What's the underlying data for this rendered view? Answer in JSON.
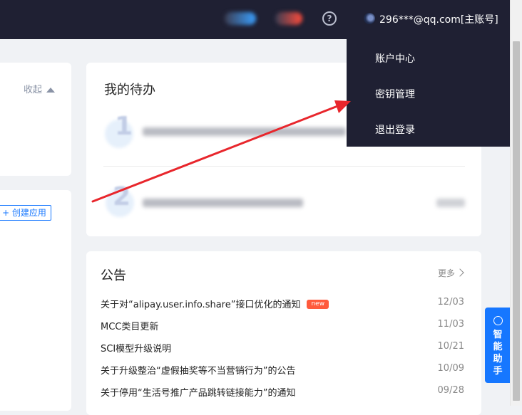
{
  "header": {
    "account_label": "296***@qq.com[主账号]",
    "help_symbol": "?"
  },
  "account_menu": {
    "items": [
      "账户中心",
      "密钥管理",
      "退出登录"
    ]
  },
  "left_panel": {
    "collapse_label": "收起",
    "create_app_label": "+ 创建应用"
  },
  "todo": {
    "title": "我的待办",
    "items": [
      {
        "index": "1"
      },
      {
        "index": "2"
      }
    ]
  },
  "announcements": {
    "title": "公告",
    "more_label": "更多",
    "items": [
      {
        "text": "关于对“alipay.user.info.share”接口优化的通知",
        "date": "12/03",
        "badge": "new"
      },
      {
        "text": "MCC类目更新",
        "date": "11/03"
      },
      {
        "text": "SCI模型升级说明",
        "date": "10/21"
      },
      {
        "text": "关于升级整治“虚假抽奖等不当营销行为”的公告",
        "date": "10/09"
      },
      {
        "text": "关于停用“生活号推广产品跳转链接能力”的通知",
        "date": "09/28"
      }
    ]
  },
  "assistant": {
    "label": "智能助手"
  },
  "colors": {
    "topbar": "#1f2033",
    "accent": "#1677ff",
    "annotation_arrow": "#e8262c",
    "badge_new": "#ff5a3c"
  }
}
